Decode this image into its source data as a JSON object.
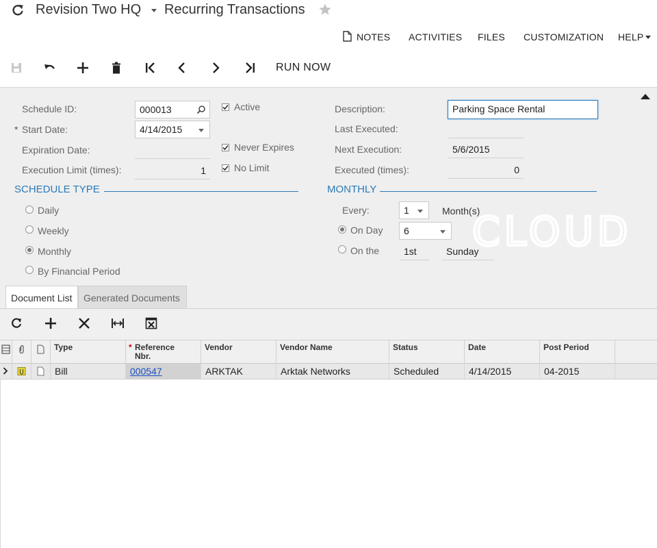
{
  "header": {
    "company": "Revision Two HQ",
    "screen_title": "Recurring Transactions"
  },
  "top_menu": {
    "notes": "NOTES",
    "activities": "ACTIVITIES",
    "files": "FILES",
    "customization": "CUSTOMIZATION",
    "help": "HELP"
  },
  "toolbar": {
    "run_now": "RUN NOW"
  },
  "form": {
    "schedule_id_label": "Schedule ID:",
    "schedule_id": "000013",
    "start_date_label": "Start Date:",
    "start_date": "4/14/2015",
    "expiration_date_label": "Expiration Date:",
    "expiration_date": "",
    "execution_limit_label": "Execution Limit (times):",
    "execution_limit": "1",
    "active_label": "Active",
    "active": true,
    "never_expires_label": "Never Expires",
    "never_expires": true,
    "no_limit_label": "No Limit",
    "no_limit": true,
    "description_label": "Description:",
    "description": "Parking Space Rental",
    "last_executed_label": "Last Executed:",
    "last_executed": "",
    "next_execution_label": "Next Execution:",
    "next_execution": "5/6/2015",
    "executed_times_label": "Executed (times):",
    "executed_times": "0"
  },
  "schedule_type": {
    "title": "SCHEDULE TYPE",
    "options": [
      "Daily",
      "Weekly",
      "Monthly",
      "By Financial Period"
    ],
    "selected": "Monthly"
  },
  "monthly": {
    "title": "MONTHLY",
    "every_label": "Every:",
    "every_value": "1",
    "every_unit": "Month(s)",
    "on_day_label": "On Day",
    "on_day_value": "6",
    "on_the_label": "On the",
    "on_the_ordinal": "1st",
    "on_the_weekday": "Sunday",
    "selected": "On Day"
  },
  "watermark": "CLOUD",
  "tabs": [
    {
      "label": "Document List",
      "active": true
    },
    {
      "label": "Generated Documents",
      "active": false
    }
  ],
  "grid": {
    "columns": [
      "Type",
      "Reference Nbr.",
      "Vendor",
      "Vendor Name",
      "Status",
      "Date",
      "Post Period"
    ],
    "rows": [
      {
        "type": "Bill",
        "reference_nbr": "000547",
        "vendor": "ARKTAK",
        "vendor_name": "Arktak Networks",
        "status": "Scheduled",
        "date": "4/14/2015",
        "post_period": "04-2015"
      }
    ]
  },
  "colors": {
    "accent_blue": "#2a7ab8",
    "link_blue": "#1a4fc4",
    "panel_bg": "#efefef",
    "required_red": "#cc0000"
  }
}
